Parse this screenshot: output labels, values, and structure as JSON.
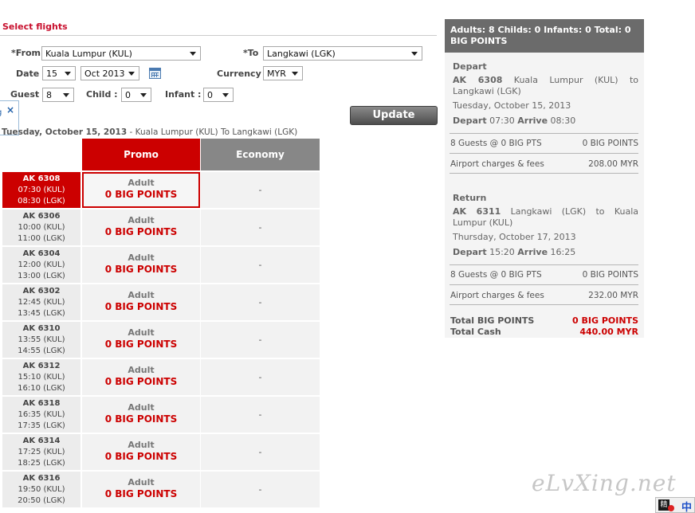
{
  "form": {
    "title": "Select flights",
    "from_label": "*From",
    "from_value": "Kuala Lumpur (KUL)",
    "to_label": "*To",
    "to_value": "Langkawi (LGK)",
    "date_label": "Date",
    "date_day": "15",
    "date_month": "Oct 2013",
    "currency_label": "Currency",
    "currency_value": "MYR",
    "guest_label": "Guest",
    "guest_value": "8",
    "child_label": "Child :",
    "child_value": "0",
    "infant_label": "Infant :",
    "infant_value": "0",
    "update_label": "Update"
  },
  "popup": {
    "close_glyph": "×",
    "edge_text": "g"
  },
  "results": {
    "date_line_bold": "Tuesday, October 15, 2013",
    "date_line_rest": " - Kuala Lumpur (KUL) To Langkawi (LGK)",
    "promo_header": "Promo",
    "economy_header": "Economy",
    "flights": [
      {
        "code": "AK 6308",
        "dep": "07:30 (KUL)",
        "arr": "08:30 (LGK)",
        "adult": "Adult",
        "promo": "0 BIG POINTS",
        "economy": "-"
      },
      {
        "code": "AK 6306",
        "dep": "10:00 (KUL)",
        "arr": "11:00 (LGK)",
        "adult": "Adult",
        "promo": "0 BIG POINTS",
        "economy": "-"
      },
      {
        "code": "AK 6304",
        "dep": "12:00 (KUL)",
        "arr": "13:00 (LGK)",
        "adult": "Adult",
        "promo": "0 BIG POINTS",
        "economy": "-"
      },
      {
        "code": "AK 6302",
        "dep": "12:45 (KUL)",
        "arr": "13:45 (LGK)",
        "adult": "Adult",
        "promo": "0 BIG POINTS",
        "economy": "-"
      },
      {
        "code": "AK 6310",
        "dep": "13:55 (KUL)",
        "arr": "14:55 (LGK)",
        "adult": "Adult",
        "promo": "0 BIG POINTS",
        "economy": "-"
      },
      {
        "code": "AK 6312",
        "dep": "15:10 (KUL)",
        "arr": "16:10 (LGK)",
        "adult": "Adult",
        "promo": "0 BIG POINTS",
        "economy": "-"
      },
      {
        "code": "AK 6318",
        "dep": "16:35 (KUL)",
        "arr": "17:35 (LGK)",
        "adult": "Adult",
        "promo": "0 BIG POINTS",
        "economy": "-"
      },
      {
        "code": "AK 6314",
        "dep": "17:25 (KUL)",
        "arr": "18:25 (LGK)",
        "adult": "Adult",
        "promo": "0 BIG POINTS",
        "economy": "-"
      },
      {
        "code": "AK 6316",
        "dep": "19:50 (KUL)",
        "arr": "20:50 (LGK)",
        "adult": "Adult",
        "promo": "0 BIG POINTS",
        "economy": "-"
      }
    ]
  },
  "summary": {
    "header": "Adults: 8 Childs: 0 Infants: 0 Total: 0 BIG POINTS",
    "depart": {
      "label": "Depart",
      "flight_code": "AK 6308",
      "route": "Kuala Lumpur (KUL) to Langkawi (LGK)",
      "date": "Tuesday, October 15, 2013",
      "depart_word": "Depart",
      "depart_time": "07:30",
      "arrive_word": "Arrive",
      "arrive_time": "08:30",
      "guests_label": "8 Guests @ 0 BIG PTS",
      "guests_value": "0 BIG POINTS",
      "fees_label": "Airport charges & fees",
      "fees_value": "208.00 MYR"
    },
    "return": {
      "label": "Return",
      "flight_code": "AK 6311",
      "route": "Langkawi (LGK) to Kuala Lumpur (KUL)",
      "date": "Thursday, October 17, 2013",
      "depart_word": "Depart",
      "depart_time": "15:20",
      "arrive_word": "Arrive",
      "arrive_time": "16:25",
      "guests_label": "8 Guests @ 0 BIG PTS",
      "guests_value": "0 BIG POINTS",
      "fees_label": "Airport charges & fees",
      "fees_value": "232.00 MYR"
    },
    "total_points_label": "Total BIG POINTS",
    "total_points_value": "0 BIG POINTS",
    "total_cash_label": "Total Cash",
    "total_cash_value": "440.00 MYR"
  },
  "watermark": "eLvXing.net",
  "tray": {
    "ime_left": "精",
    "ime_right": "中"
  }
}
